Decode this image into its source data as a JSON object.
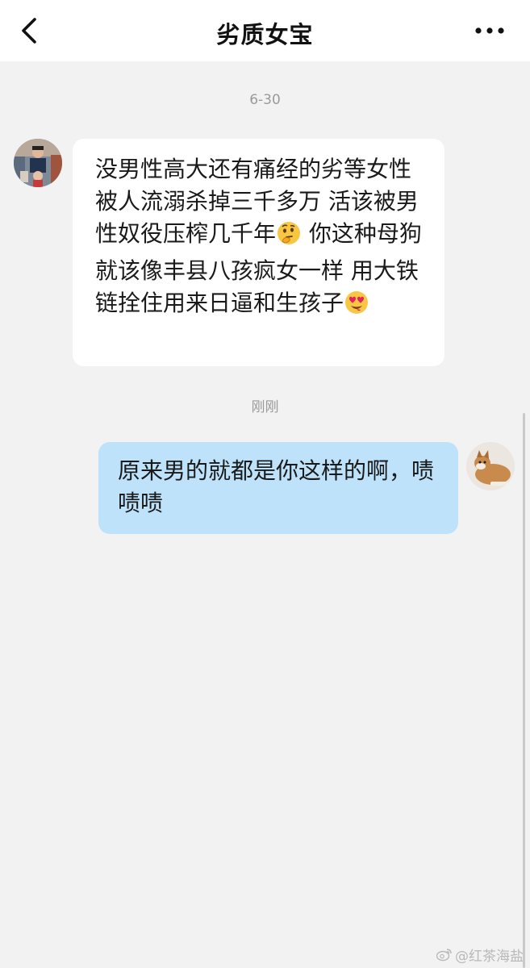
{
  "header": {
    "title": "劣质女宝"
  },
  "messages": {
    "timestamp_1": "6-30",
    "incoming_text": "没男性高大还有痛经的劣等女性 被人流溺杀掉三千多万 活该被男性奴役压榨几千年",
    "incoming_text_2": " 你这种母狗就该像丰县八孩疯女一样 用大铁链拴住用来日逼和生孩子",
    "timestamp_2": "刚刚",
    "outgoing_text": "原来男的就都是你这样的啊，啧啧啧"
  },
  "watermark": {
    "text": "@红茶海盐"
  },
  "colors": {
    "header_bg": "#ffffff",
    "page_bg": "#f2f2f2",
    "incoming_bubble": "#ffffff",
    "outgoing_bubble": "#bde2fa"
  },
  "icons": {
    "back": "chevron-left-icon",
    "more": "more-dots-icon",
    "emoji_1": "thinking-face-emoji",
    "emoji_2": "heart-eyes-emoji"
  }
}
